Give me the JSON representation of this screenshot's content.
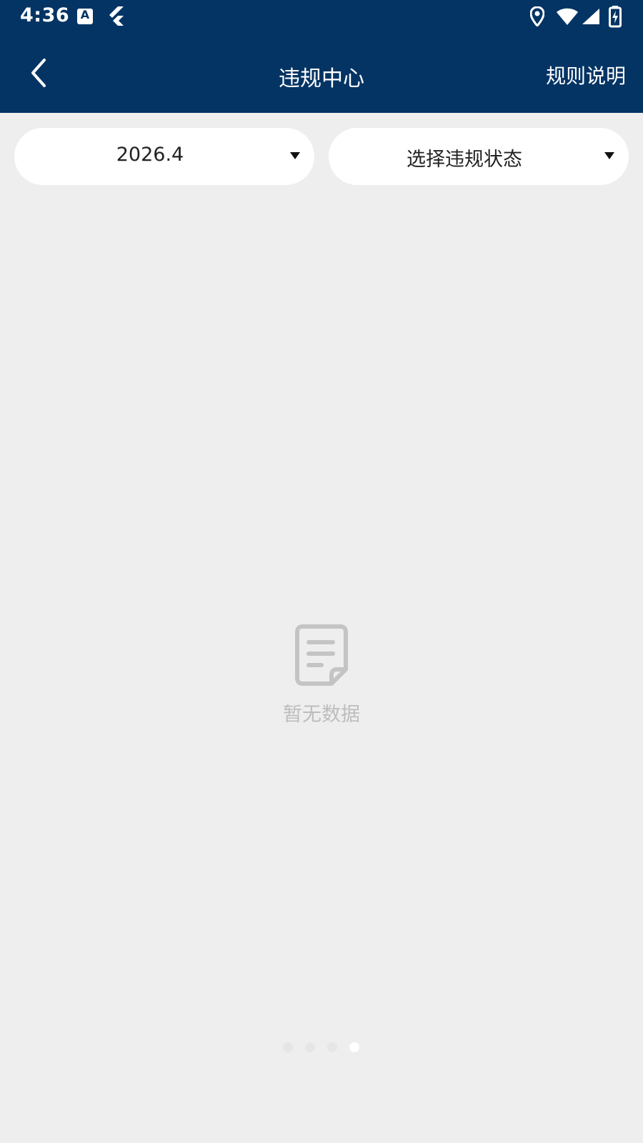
{
  "status_bar": {
    "time": "4:36",
    "icons": [
      "accessibility-a-icon",
      "flutter-icon",
      "location-icon",
      "wifi-icon",
      "cell-signal-icon",
      "battery-charging-icon"
    ]
  },
  "header": {
    "title": "违规中心",
    "action_label": "规则说明",
    "back_icon": "back-chevron-icon"
  },
  "filters": {
    "month": {
      "value": "2026.4"
    },
    "status": {
      "placeholder": "选择违规状态"
    }
  },
  "empty_state": {
    "icon": "document-icon",
    "text": "暂无数据"
  },
  "pager": {
    "count": 4,
    "active_index": 3
  },
  "colors": {
    "header_bg": "#043464",
    "page_bg": "#eeeeee",
    "empty_text": "#bdbdbd"
  }
}
